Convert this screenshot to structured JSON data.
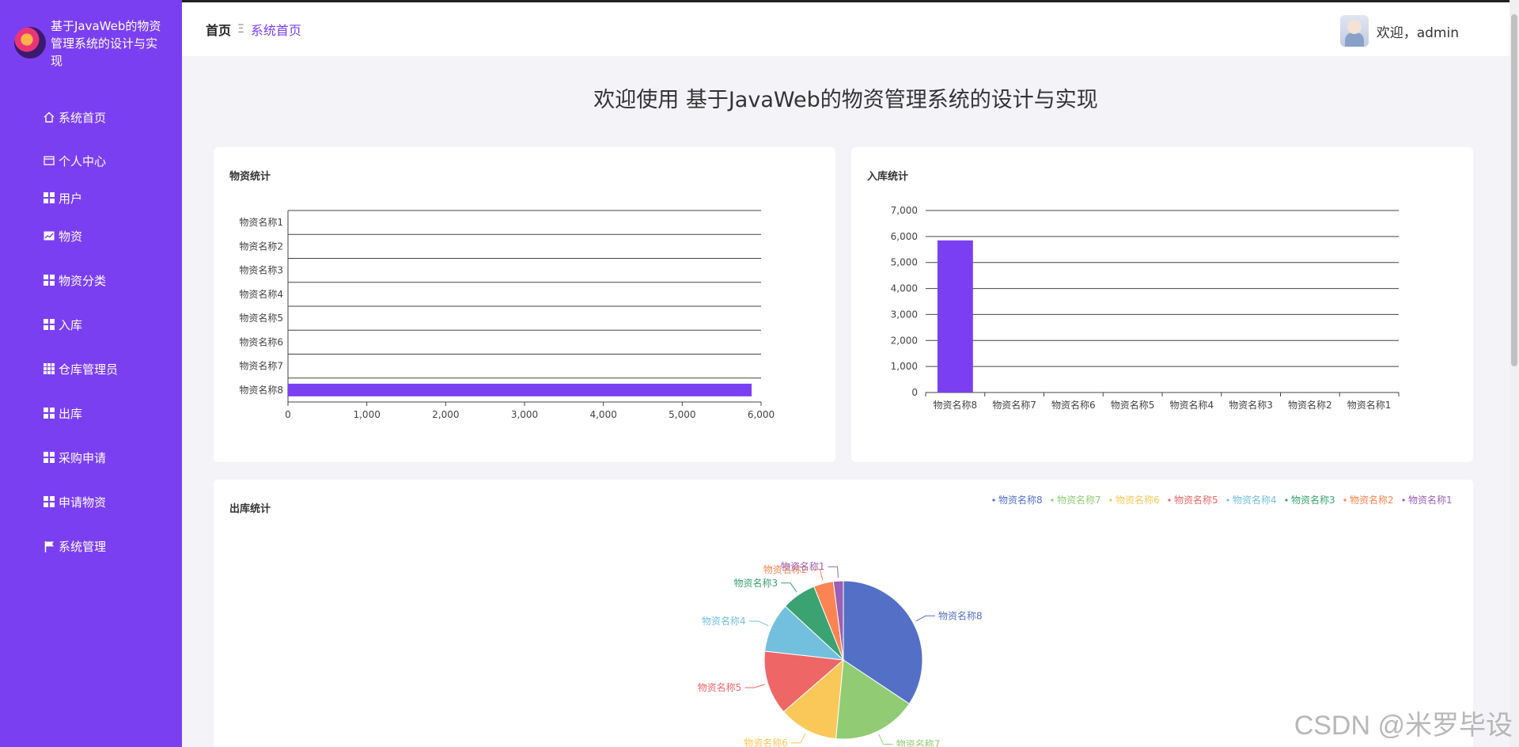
{
  "app": {
    "title": "基于JavaWeb的物资管理系统的设计与实现"
  },
  "sidebar": {
    "items": [
      {
        "label": "系统首页",
        "icon": "home-icon"
      },
      {
        "label": "个人中心",
        "icon": "card-icon"
      },
      {
        "label": "用户",
        "icon": "grid-icon"
      },
      {
        "label": "物资",
        "icon": "chart-icon"
      },
      {
        "label": "物资分类",
        "icon": "grid-icon"
      },
      {
        "label": "入库",
        "icon": "grid-icon"
      },
      {
        "label": "仓库管理员",
        "icon": "grid9-icon"
      },
      {
        "label": "出库",
        "icon": "grid-icon"
      },
      {
        "label": "采购申请",
        "icon": "grid-icon"
      },
      {
        "label": "申请物资",
        "icon": "grid-icon"
      },
      {
        "label": "系统管理",
        "icon": "flag-icon"
      }
    ]
  },
  "header": {
    "breadcrumb_home": "首页",
    "breadcrumb_sep": "Ξ",
    "breadcrumb_current": "系统首页",
    "welcome_user": "欢迎，admin"
  },
  "main": {
    "welcome_title": "欢迎使用 基于JavaWeb的物资管理系统的设计与实现"
  },
  "watermark": "CSDN @米罗毕设",
  "colors": {
    "accent": "#7b3ff2",
    "sidebar_bg": "#7b3ff2"
  },
  "chart_data": [
    {
      "type": "bar",
      "orientation": "horizontal",
      "title": "物资统计",
      "categories": [
        "物资名称1",
        "物资名称2",
        "物资名称3",
        "物资名称4",
        "物资名称5",
        "物资名称6",
        "物资名称7",
        "物资名称8"
      ],
      "values": [
        0,
        0,
        0,
        0,
        0,
        0,
        0,
        5880
      ],
      "xlim": [
        0,
        6000
      ],
      "ticks": [
        0,
        1000,
        2000,
        3000,
        4000,
        5000,
        6000
      ],
      "tick_labels": [
        "0",
        "1,000",
        "2,000",
        "3,000",
        "4,000",
        "5,000",
        "6,000"
      ],
      "grid": true,
      "color": "#7b3ff2"
    },
    {
      "type": "bar",
      "title": "入库统计",
      "categories": [
        "物资名称8",
        "物资名称7",
        "物资名称6",
        "物资名称5",
        "物资名称4",
        "物资名称3",
        "物资名称2",
        "物资名称1"
      ],
      "values": [
        5850,
        0,
        0,
        0,
        0,
        0,
        0,
        0
      ],
      "ylim": [
        0,
        7000
      ],
      "ticks": [
        0,
        1000,
        2000,
        3000,
        4000,
        5000,
        6000,
        7000
      ],
      "tick_labels": [
        "0",
        "1,000",
        "2,000",
        "3,000",
        "4,000",
        "5,000",
        "6,000",
        "7,000"
      ],
      "grid": true,
      "color": "#7b3ff2"
    },
    {
      "type": "pie",
      "title": "出库统计",
      "legend_position": "top-right",
      "slices": [
        {
          "name": "物资名称8",
          "value": 34,
          "color": "#5470c6"
        },
        {
          "name": "物资名称7",
          "value": 17,
          "color": "#91cc75"
        },
        {
          "name": "物资名称6",
          "value": 12,
          "color": "#fac858"
        },
        {
          "name": "物资名称5",
          "value": 13,
          "color": "#ee6666"
        },
        {
          "name": "物资名称4",
          "value": 10,
          "color": "#73c0de"
        },
        {
          "name": "物资名称3",
          "value": 7,
          "color": "#3ba272"
        },
        {
          "name": "物资名称2",
          "value": 4,
          "color": "#fc8452"
        },
        {
          "name": "物资名称1",
          "value": 2,
          "color": "#9a60b4"
        }
      ]
    }
  ]
}
